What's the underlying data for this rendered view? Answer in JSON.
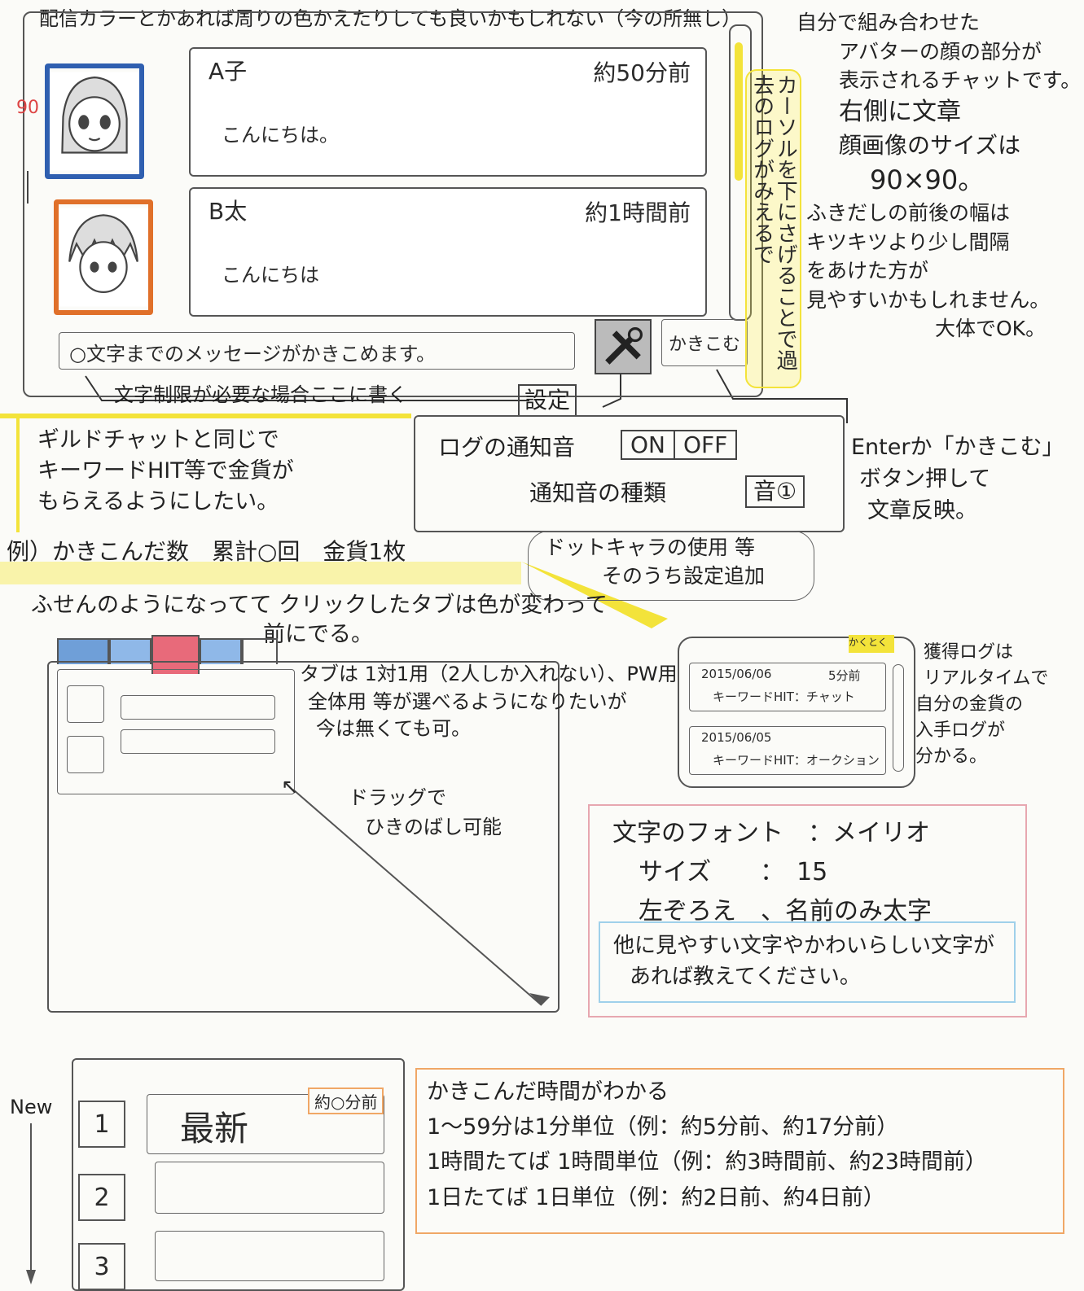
{
  "top_note": "配信カラーとかあれば周りの色かえたりしても良いかもしれない（今の所無し）",
  "chat": {
    "messages": [
      {
        "name": "A子",
        "time": "約50分前",
        "text": "こんにちは。"
      },
      {
        "name": "B太",
        "time": "約1時間前",
        "text": "こんにちは"
      }
    ],
    "input_placeholder": "○文字までのメッセージがかきこめます。",
    "write_button": "かきこむ",
    "avatar_size_label": "90"
  },
  "annotations": {
    "scroll_note": "カーソルを下にさげることで過去のログがみえるで",
    "char_limit_note": "文字制限が必要な場合ここに書く",
    "settings_label": "設定",
    "enter_note": [
      "Enterか「かきこむ」",
      "ボタン押して",
      "文章反映。"
    ],
    "right_notes": [
      "自分で組み合わせた",
      "アバターの顔の部分が",
      "表示されるチャットです。",
      "右側に文章",
      "顔画像のサイズは",
      "90×90。",
      "ふきだしの前後の幅は",
      "キツキツより少し間隔",
      "をあけた方が",
      "見やすいかもしれません。",
      "大体でOK。"
    ]
  },
  "guild_note": {
    "lines": [
      "ギルドチャットと同じで",
      "キーワードHIT等で金貨が",
      "もらえるようにしたい。"
    ],
    "example": "例）かきこんだ数　累計○回　金貨1枚"
  },
  "settings_panel": {
    "log_sound_label": "ログの通知音",
    "on": "ON",
    "off": "OFF",
    "sound_type_label": "通知音の種類",
    "sound_value": "音①",
    "future_note": [
      "ドットキャラの使用 等",
      "そのうち設定追加"
    ]
  },
  "tabs_note": {
    "headline": [
      "ふせんのようになってて クリックしたタブは色が変わって",
      "前にでる。"
    ],
    "desc": [
      "タブは 1対1用（2人しか入れない）、PW用",
      "全体用 等が選べるようになりたいが",
      "今は無くても可。"
    ],
    "drag": [
      "ドラッグで",
      "ひきのばし可能"
    ]
  },
  "log_window": {
    "tab_label": "かくとく",
    "entries": [
      {
        "date": "2015/06/06",
        "time": "5分前",
        "text": "キーワードHIT：チャット"
      },
      {
        "date": "2015/06/05",
        "text": "キーワードHIT：オークション"
      }
    ],
    "note": [
      "獲得ログは",
      "リアルタイムで",
      "自分の金貨の",
      "入手ログが",
      "分かる。"
    ]
  },
  "font_box": {
    "font_line": "文字のフォント　：メイリオ",
    "size_line": "サイズ　　：　15",
    "align_line": "左ぞろえ　、名前のみ太字",
    "note": [
      "他に見やすい文字やかわいらしい文字が",
      "あれば教えてください。"
    ]
  },
  "list": {
    "new_label": "New",
    "items": [
      "1",
      "2",
      "3"
    ],
    "latest_text": "最新",
    "latest_time": "約○分前"
  },
  "time_rules": {
    "lines": [
      "かきこんだ時間がわかる",
      "1〜59分は1分単位（例：約5分前、約17分前）",
      "1時間たてば 1時間単位（例：約3時間前、約23時間前）",
      "1日たてば 1日単位（例：約2日前、約4日前）"
    ]
  },
  "colors": {
    "blue_frame": "#2f5fb0",
    "orange_frame": "#e0702a",
    "yellow": "#f3e33a",
    "pink": "#e7a7b0",
    "light_blue": "#9fd0ea",
    "orange_border": "#f0a766",
    "tab_red": "#e86a7a",
    "tab_blue": "#6f9fd8"
  }
}
